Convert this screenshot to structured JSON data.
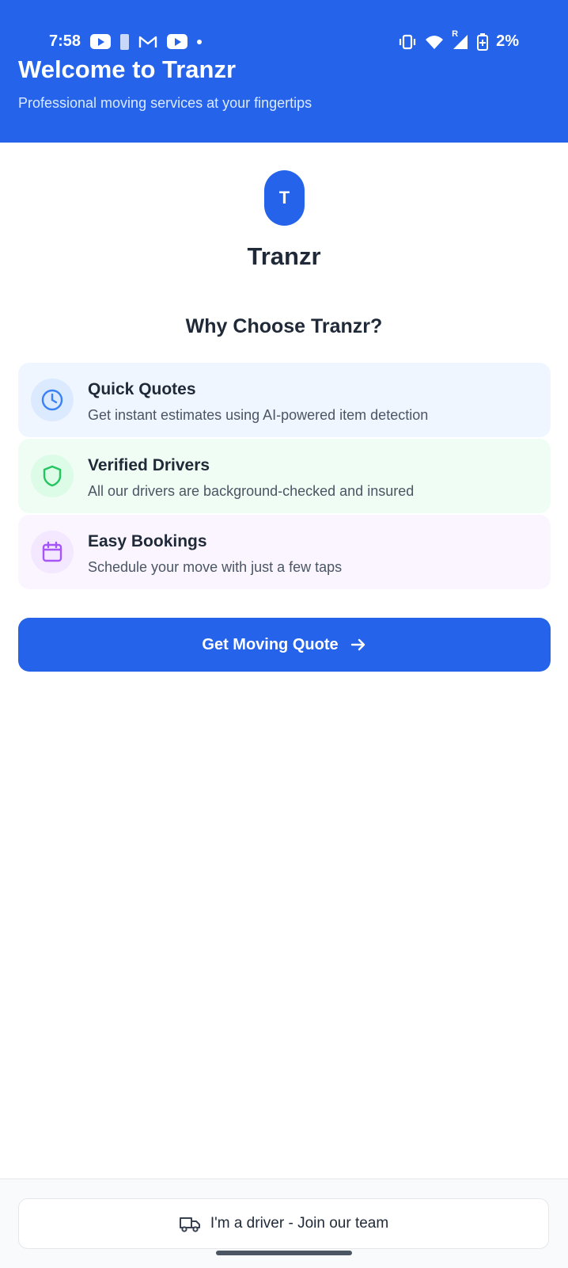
{
  "status_bar": {
    "time": "7:58",
    "battery": "2%",
    "network_badge": "R"
  },
  "header": {
    "title": "Welcome to Tranzr",
    "subtitle": "Professional moving services at your fingertips"
  },
  "brand": {
    "logo_letter": "T",
    "name": "Tranzr"
  },
  "section_title": "Why Choose Tranzr?",
  "features": [
    {
      "title": "Quick Quotes",
      "description": "Get instant estimates using AI-powered item detection",
      "icon": "clock-icon",
      "bg": "#eff6ff",
      "icon_bg": "#dbeafe",
      "icon_color": "#3b82f6"
    },
    {
      "title": "Verified Drivers",
      "description": "All our drivers are background-checked and insured",
      "icon": "shield-icon",
      "bg": "#f0fdf4",
      "icon_bg": "#dcfce7",
      "icon_color": "#22c55e"
    },
    {
      "title": "Easy Bookings",
      "description": "Schedule your move with just a few taps",
      "icon": "calendar-icon",
      "bg": "#faf5ff",
      "icon_bg": "#f3e8ff",
      "icon_color": "#a855f7"
    }
  ],
  "cta": {
    "label": "Get Moving Quote",
    "icon": "arrow-right-icon"
  },
  "footer": {
    "driver_label": "I'm a driver - Join our team",
    "icon": "truck-icon"
  },
  "colors": {
    "primary": "#2563eb"
  }
}
